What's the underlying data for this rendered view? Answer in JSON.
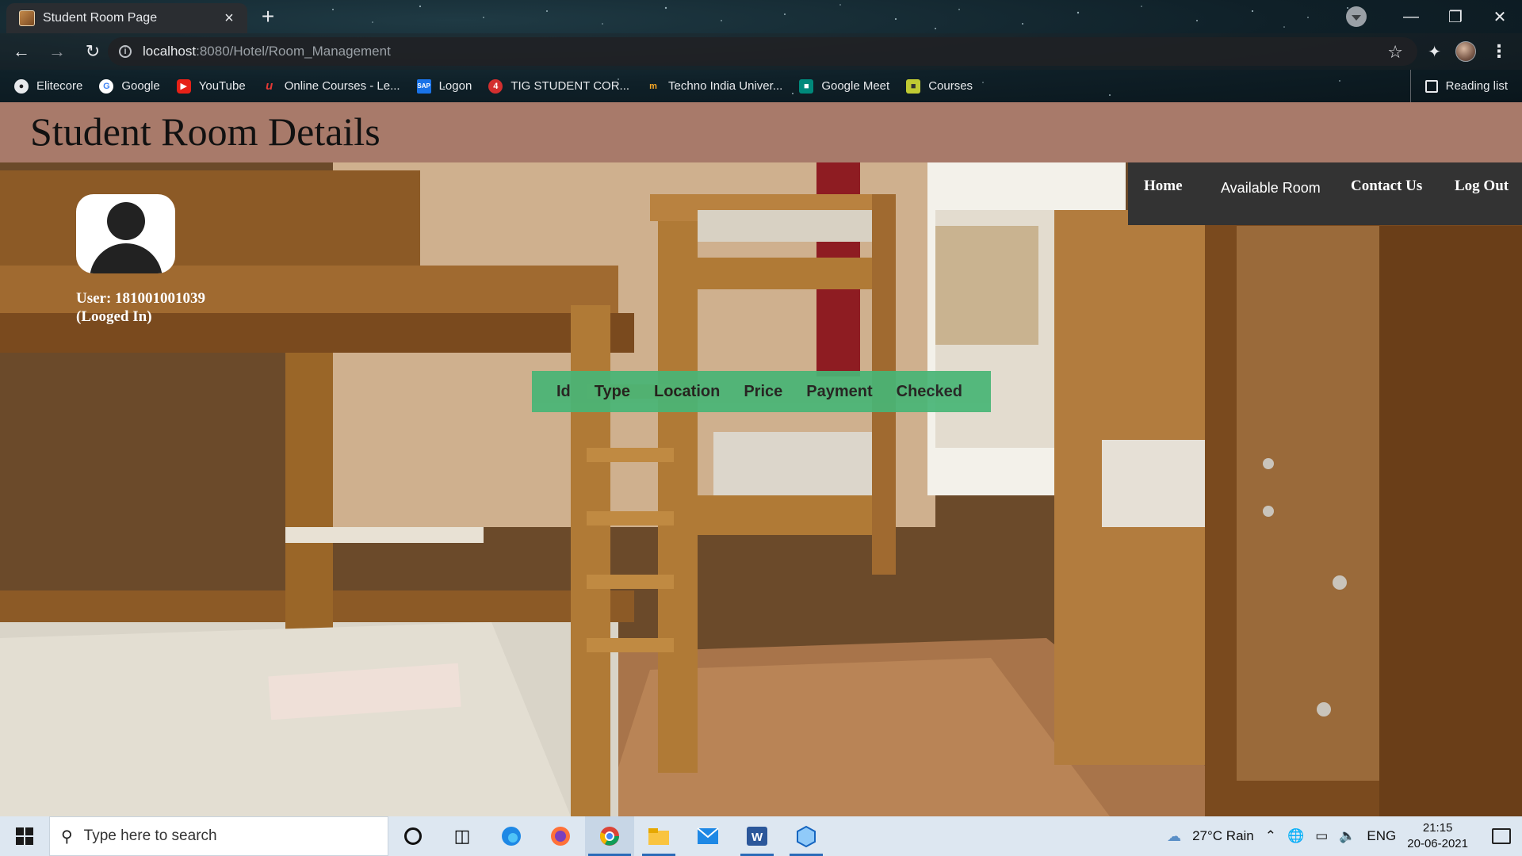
{
  "browser": {
    "tab_title": "Student Room Page",
    "tab_close": "×",
    "new_tab": "+",
    "url_host": "localhost",
    "url_path": ":8080/Hotel/Room_Management",
    "bookmarks": [
      "Elitecore",
      "Google",
      "YouTube",
      "Online Courses - Le...",
      "Logon",
      "TIG STUDENT COR...",
      "Techno India Univer...",
      "Google Meet",
      "Courses"
    ],
    "reading_list": "Reading list"
  },
  "page": {
    "title": "Student Room Details",
    "nav": {
      "home": "Home",
      "available_room": "Available Room",
      "contact_us": "Contact Us",
      "log_out": "Log Out"
    },
    "user": {
      "line1": "User: 181001001039",
      "line2": "(Looged In)"
    },
    "table_headers": [
      "Id",
      "Type",
      "Location",
      "Price",
      "Payment",
      "Checked"
    ]
  },
  "taskbar": {
    "search_placeholder": "Type here to search",
    "weather": "27°C  Rain",
    "language": "ENG",
    "time": "21:15",
    "date": "20-06-2021"
  }
}
